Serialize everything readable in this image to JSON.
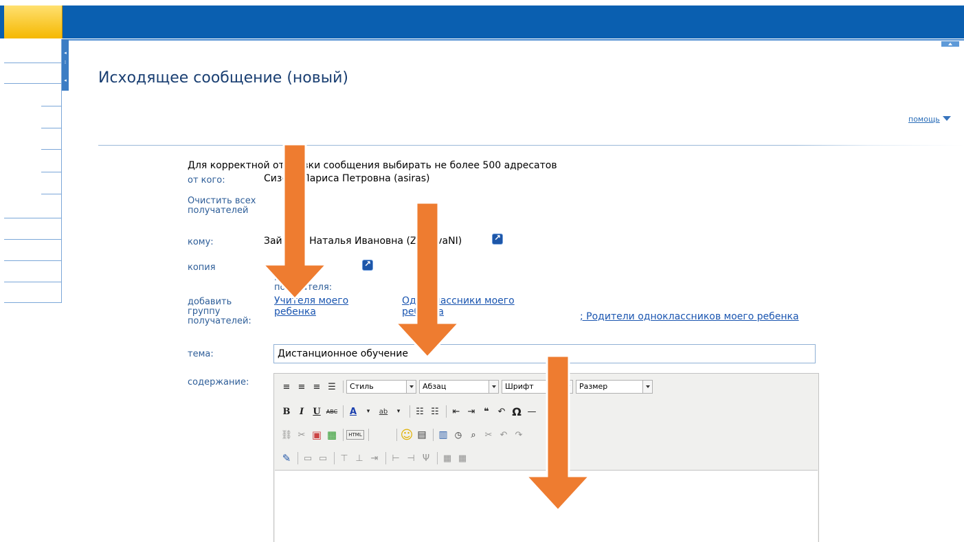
{
  "page": {
    "title": "Исходящее сообщение (новый)",
    "help": "помощь"
  },
  "form": {
    "notice": "Для корректной отправки сообщения выбирать не более 500 адресатов",
    "from_label": "от кого:",
    "from_value": "Сизова Лариса Петровна (asiras)",
    "clear_label": "Очистить всех получателей",
    "to_label": "кому:",
    "to_value": "Зайцева Наталья Ивановна (ZaicevaNI)",
    "cc_label": "копия",
    "cc_hint": "Копия получателя:",
    "group_label": "добавить группу получателей:",
    "group_links": [
      "Учителя моего ребенка",
      "Одноклассники моего ребенка",
      "; Родители одноклассников моего ребенка"
    ],
    "subject_label": "тема:",
    "subject_value": "Дистанционное обучение",
    "content_label": "содержание:"
  },
  "editor": {
    "style_select": "Стиль",
    "format_select": "Абзац",
    "font_select": "Шрифт",
    "size_select": "Размер"
  },
  "colors": {
    "topbar": "#0a5fb0",
    "label": "#2d5d98",
    "link": "#1a55b0",
    "arrow": "#ee7c30"
  }
}
